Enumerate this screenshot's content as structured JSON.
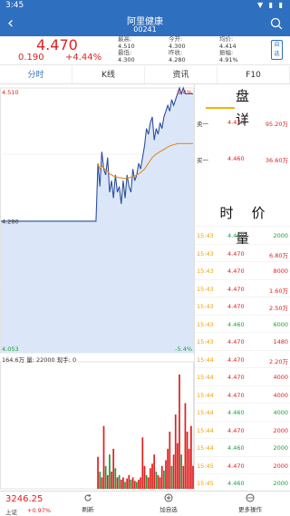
{
  "status": {
    "time": "3:45",
    "icons": "▼ ▮ ▮"
  },
  "nav": {
    "title": "阿里健康",
    "code": "00241"
  },
  "quote": {
    "price": "4.470",
    "change": "0.190",
    "pct": "+4.44%",
    "stats": [
      {
        "k": "最高:",
        "v": "4.510"
      },
      {
        "k": "最低:",
        "v": "4.300"
      },
      {
        "k": "今开:",
        "v": "4.300"
      },
      {
        "k": "昨收:",
        "v": "4.280"
      },
      {
        "k": "均价:",
        "v": "4.414"
      },
      {
        "k": "振幅:",
        "v": "4.91%"
      }
    ],
    "self_btn": "自选"
  },
  "tabs": [
    "分时",
    "K线",
    "资讯",
    "F10"
  ],
  "chart": {
    "high_label": "4.510",
    "high_pct": "5.4%",
    "mid_label": "4.280",
    "low_label": "4.053",
    "low_pct": "-5.4%",
    "vol_total": "164.6万",
    "vol_label": "量:",
    "vol_value": "22000",
    "hand_label": "现手:",
    "hand_value": "0",
    "colors": {
      "price": "#2b4fa0",
      "avg": "#e58a1e",
      "up": "#e02020",
      "down": "#1c9e3a",
      "fill": "#dbe7f8"
    }
  },
  "chart_data": {
    "type": "line",
    "title": "",
    "ylim": [
      4.053,
      4.51
    ],
    "prev_close": 4.28,
    "series": [
      {
        "values": [
          4.28,
          4.28,
          4.28,
          4.28,
          4.28,
          4.28,
          4.28,
          4.28,
          4.28,
          4.28,
          4.28,
          4.28,
          4.28,
          4.28,
          4.28,
          4.28,
          4.28,
          4.28,
          4.28,
          4.28,
          4.28,
          4.28,
          4.28,
          4.28,
          4.28,
          4.28,
          4.28,
          4.28,
          4.28,
          4.28,
          4.28,
          4.28,
          4.28,
          4.28,
          4.28,
          4.28,
          4.28,
          4.28,
          4.28,
          4.28,
          4.28,
          4.28,
          4.28,
          4.28,
          4.28,
          4.28,
          4.28,
          4.28,
          4.28,
          4.28,
          4.38,
          4.34,
          4.4,
          4.37,
          4.36,
          4.39,
          4.33,
          4.35,
          4.32,
          4.36,
          4.33,
          4.34,
          4.31,
          4.35,
          4.32,
          4.36,
          4.34,
          4.33,
          4.37,
          4.35,
          4.36,
          4.38,
          4.37,
          4.39,
          4.41,
          4.44,
          4.43,
          4.45,
          4.46,
          4.42,
          4.44,
          4.43,
          4.45,
          4.44,
          4.46,
          4.47,
          4.48,
          4.47,
          4.49,
          4.48,
          4.49,
          4.5,
          4.51,
          4.5,
          4.51,
          4.5,
          4.5,
          4.5,
          4.5,
          4.5
        ]
      },
      {
        "values": [
          null,
          null,
          null,
          null,
          null,
          null,
          null,
          null,
          null,
          null,
          null,
          null,
          null,
          null,
          null,
          null,
          null,
          null,
          null,
          null,
          null,
          null,
          null,
          null,
          null,
          null,
          null,
          null,
          null,
          null,
          null,
          null,
          null,
          null,
          null,
          null,
          null,
          null,
          null,
          null,
          null,
          null,
          null,
          null,
          null,
          null,
          null,
          null,
          null,
          null,
          4.38,
          4.37,
          4.375,
          4.372,
          4.368,
          4.366,
          4.362,
          4.36,
          4.358,
          4.357,
          4.356,
          4.355,
          4.355,
          4.354,
          4.354,
          4.355,
          4.355,
          4.356,
          4.357,
          4.358,
          4.36,
          4.362,
          4.364,
          4.367,
          4.37,
          4.375,
          4.38,
          4.385,
          4.39,
          4.393,
          4.396,
          4.398,
          4.4,
          4.402,
          4.404,
          4.406,
          4.408,
          4.41,
          4.411,
          4.412,
          4.413,
          4.414,
          4.414,
          4.414,
          4.414,
          4.414,
          4.414,
          4.414,
          4.414,
          4.414
        ]
      }
    ]
  },
  "volume_data": [
    {
      "v": 0,
      "d": "up"
    },
    {
      "v": 0,
      "d": "up"
    },
    {
      "v": 0,
      "d": "up"
    },
    {
      "v": 0,
      "d": "up"
    },
    {
      "v": 0,
      "d": "up"
    },
    {
      "v": 0,
      "d": "up"
    },
    {
      "v": 0,
      "d": "up"
    },
    {
      "v": 0,
      "d": "up"
    },
    {
      "v": 0,
      "d": "up"
    },
    {
      "v": 0,
      "d": "up"
    },
    {
      "v": 0,
      "d": "up"
    },
    {
      "v": 0,
      "d": "up"
    },
    {
      "v": 0,
      "d": "up"
    },
    {
      "v": 0,
      "d": "up"
    },
    {
      "v": 0,
      "d": "up"
    },
    {
      "v": 0,
      "d": "up"
    },
    {
      "v": 0,
      "d": "up"
    },
    {
      "v": 0,
      "d": "up"
    },
    {
      "v": 0,
      "d": "up"
    },
    {
      "v": 0,
      "d": "up"
    },
    {
      "v": 0,
      "d": "up"
    },
    {
      "v": 0,
      "d": "up"
    },
    {
      "v": 0,
      "d": "up"
    },
    {
      "v": 0,
      "d": "up"
    },
    {
      "v": 0,
      "d": "up"
    },
    {
      "v": 0,
      "d": "up"
    },
    {
      "v": 0,
      "d": "up"
    },
    {
      "v": 0,
      "d": "up"
    },
    {
      "v": 0,
      "d": "up"
    },
    {
      "v": 0,
      "d": "up"
    },
    {
      "v": 0,
      "d": "up"
    },
    {
      "v": 0,
      "d": "up"
    },
    {
      "v": 0,
      "d": "up"
    },
    {
      "v": 0,
      "d": "up"
    },
    {
      "v": 0,
      "d": "up"
    },
    {
      "v": 0,
      "d": "up"
    },
    {
      "v": 0,
      "d": "up"
    },
    {
      "v": 0,
      "d": "up"
    },
    {
      "v": 0,
      "d": "up"
    },
    {
      "v": 0,
      "d": "up"
    },
    {
      "v": 0,
      "d": "up"
    },
    {
      "v": 0,
      "d": "up"
    },
    {
      "v": 0,
      "d": "up"
    },
    {
      "v": 0,
      "d": "up"
    },
    {
      "v": 0,
      "d": "up"
    },
    {
      "v": 0,
      "d": "up"
    },
    {
      "v": 0,
      "d": "up"
    },
    {
      "v": 0,
      "d": "up"
    },
    {
      "v": 0,
      "d": "up"
    },
    {
      "v": 0,
      "d": "up"
    },
    {
      "v": 0.28,
      "d": "up"
    },
    {
      "v": 0.15,
      "d": "down"
    },
    {
      "v": 0.1,
      "d": "up"
    },
    {
      "v": 0.55,
      "d": "up"
    },
    {
      "v": 0.2,
      "d": "down"
    },
    {
      "v": 0.12,
      "d": "up"
    },
    {
      "v": 0.3,
      "d": "down"
    },
    {
      "v": 0.15,
      "d": "up"
    },
    {
      "v": 0.35,
      "d": "up"
    },
    {
      "v": 0.18,
      "d": "down"
    },
    {
      "v": 0.1,
      "d": "up"
    },
    {
      "v": 0.12,
      "d": "down"
    },
    {
      "v": 0.08,
      "d": "up"
    },
    {
      "v": 0.1,
      "d": "up"
    },
    {
      "v": 0.06,
      "d": "down"
    },
    {
      "v": 0.09,
      "d": "up"
    },
    {
      "v": 0.12,
      "d": "up"
    },
    {
      "v": 0.08,
      "d": "down"
    },
    {
      "v": 0.1,
      "d": "up"
    },
    {
      "v": 0.07,
      "d": "up"
    },
    {
      "v": 0.06,
      "d": "down"
    },
    {
      "v": 0.08,
      "d": "up"
    },
    {
      "v": 0.1,
      "d": "up"
    },
    {
      "v": 0.45,
      "d": "up"
    },
    {
      "v": 0.2,
      "d": "up"
    },
    {
      "v": 0.12,
      "d": "down"
    },
    {
      "v": 0.1,
      "d": "up"
    },
    {
      "v": 0.18,
      "d": "up"
    },
    {
      "v": 0.22,
      "d": "up"
    },
    {
      "v": 0.3,
      "d": "up"
    },
    {
      "v": 0.15,
      "d": "down"
    },
    {
      "v": 0.12,
      "d": "up"
    },
    {
      "v": 0.1,
      "d": "up"
    },
    {
      "v": 0.2,
      "d": "up"
    },
    {
      "v": 0.16,
      "d": "down"
    },
    {
      "v": 0.25,
      "d": "up"
    },
    {
      "v": 0.35,
      "d": "up"
    },
    {
      "v": 0.5,
      "d": "up"
    },
    {
      "v": 0.2,
      "d": "down"
    },
    {
      "v": 0.3,
      "d": "up"
    },
    {
      "v": 0.65,
      "d": "up"
    },
    {
      "v": 0.4,
      "d": "up"
    },
    {
      "v": 1.0,
      "d": "up"
    },
    {
      "v": 0.3,
      "d": "down"
    },
    {
      "v": 0.2,
      "d": "up"
    },
    {
      "v": 0.75,
      "d": "up"
    },
    {
      "v": 0.5,
      "d": "up"
    },
    {
      "v": 0.35,
      "d": "up"
    },
    {
      "v": 0.55,
      "d": "up"
    },
    {
      "v": 0.2,
      "d": "up"
    }
  ],
  "panel": {
    "title": "盘详",
    "bids": [
      {
        "label": "卖一",
        "price": "4.470",
        "vol": "95.20万"
      },
      {
        "label": "买一",
        "price": "4.460",
        "vol": "36.60万"
      }
    ],
    "ticks_title": "时价量",
    "ticks": [
      {
        "t": "15:43",
        "p": "4.460",
        "v": "2000",
        "c": "#1c9e3a"
      },
      {
        "t": "15:43",
        "p": "4.470",
        "v": "6.80万",
        "c": "#e02020"
      },
      {
        "t": "15:43",
        "p": "4.470",
        "v": "8000",
        "c": "#e02020"
      },
      {
        "t": "15:43",
        "p": "4.470",
        "v": "1.60万",
        "c": "#e02020"
      },
      {
        "t": "15:43",
        "p": "4.470",
        "v": "2.50万",
        "c": "#e02020"
      },
      {
        "t": "15:43",
        "p": "4.460",
        "v": "6000",
        "c": "#1c9e3a"
      },
      {
        "t": "15:43",
        "p": "4.470",
        "v": "1480",
        "c": "#e02020"
      },
      {
        "t": "15:44",
        "p": "4.470",
        "v": "2.20万",
        "c": "#e02020"
      },
      {
        "t": "15:44",
        "p": "4.470",
        "v": "4000",
        "c": "#e02020"
      },
      {
        "t": "15:44",
        "p": "4.470",
        "v": "4000",
        "c": "#e02020"
      },
      {
        "t": "15:44",
        "p": "4.460",
        "v": "4000",
        "c": "#1c9e3a"
      },
      {
        "t": "15:44",
        "p": "4.470",
        "v": "2000",
        "c": "#e02020"
      },
      {
        "t": "15:44",
        "p": "4.460",
        "v": "2000",
        "c": "#1c9e3a"
      },
      {
        "t": "15:45",
        "p": "4.470",
        "v": "2000",
        "c": "#e02020"
      },
      {
        "t": "15:45",
        "p": "4.460",
        "v": "2000",
        "c": "#1c9e3a"
      }
    ]
  },
  "bottom": {
    "index_value": "3246.25",
    "index_name": "上证",
    "index_pct": "+0.97%",
    "buttons": [
      "刷新",
      "加自选",
      "更多操作"
    ]
  }
}
